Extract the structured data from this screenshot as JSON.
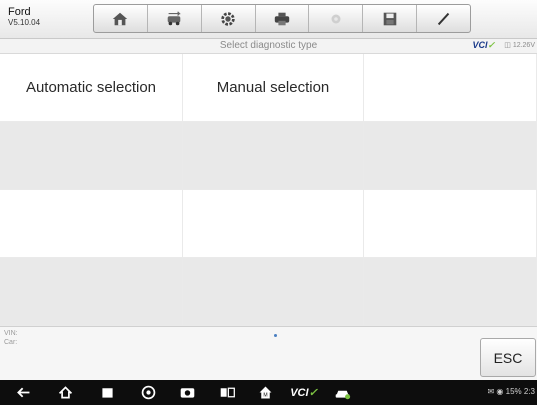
{
  "app": {
    "name": "Ford",
    "version": "V5.10.04"
  },
  "toolbar": {
    "buttons": [
      {
        "icon": "home-icon"
      },
      {
        "icon": "vehicle-swap-icon"
      },
      {
        "icon": "gear-icon"
      },
      {
        "icon": "printer-icon"
      },
      {
        "icon": "help-icon"
      },
      {
        "icon": "save-icon"
      },
      {
        "icon": "pen-icon"
      }
    ]
  },
  "subtitle": "Select diagnostic type",
  "vci": {
    "prefix": "VCI",
    "mark": "✓"
  },
  "battery_voltage": "12.26V",
  "options": {
    "automatic": "Automatic selection",
    "manual": "Manual selection"
  },
  "info": {
    "vin_label": "VIN:",
    "car_label": "Car:"
  },
  "esc_label": "ESC",
  "navbar": {
    "vci_label": "VCI",
    "status_text": "15% 2:3"
  },
  "colors": {
    "accent": "#1a3a8a",
    "vci_green": "#7cc242",
    "navbar": "#0d0d0d"
  }
}
